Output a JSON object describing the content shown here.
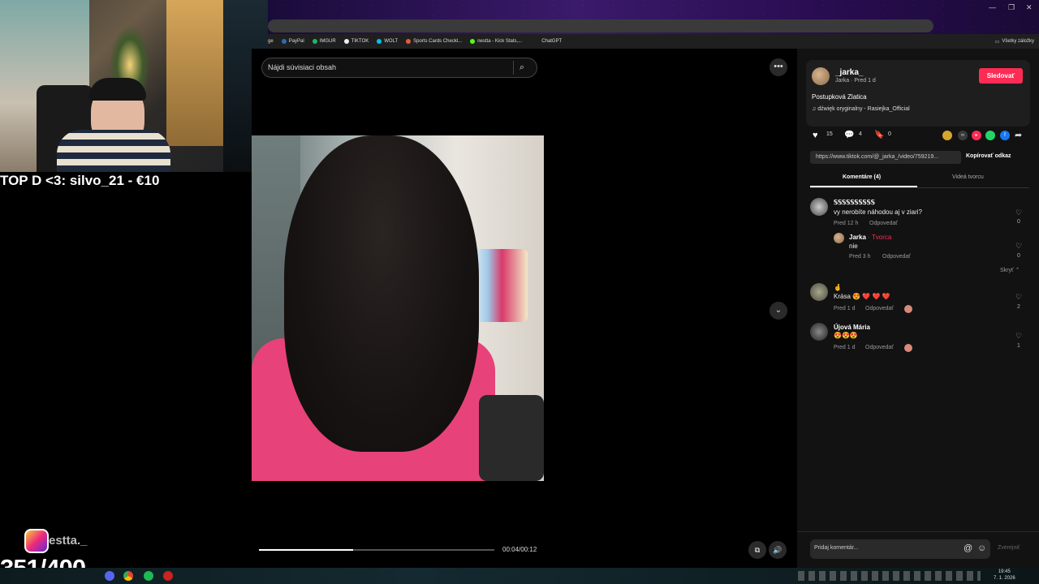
{
  "stream": {
    "donation_text": "TOP D <3: silvo_21 - €10",
    "instagram_handle": "estta._",
    "counter": "351/400"
  },
  "browser": {
    "bookmarks": [
      "ge",
      "PayPal",
      "IMGUR",
      "TIKTOK",
      "WOLT",
      "Sports Cards Checkl...",
      "nestta - Kick Stats,...",
      "ChatGPT"
    ],
    "all_bookmarks": "Všetky záložky"
  },
  "video": {
    "search_placeholder": "Nájdi súvisiaci obsah",
    "time": "00:04/00:12",
    "progress": 0.4
  },
  "author": {
    "username": "_jarka_",
    "subline": "Jarka · Pred 1 d",
    "follow_label": "Sledovať",
    "caption": "Postupková Zlatica",
    "music": "dźwięk oryginalny - Rasiejka_Official"
  },
  "stats": {
    "likes": "15",
    "comments": "4",
    "saves": "0"
  },
  "link": {
    "url": "https://www.tiktok.com/@_jarka_/video/759219...",
    "copy_label": "Kopírovať odkaz"
  },
  "tabs": {
    "comments": "Komentáre (4)",
    "creator_videos": "Videá tvorcu"
  },
  "comments": [
    {
      "name": "𝕊𝕊𝕊𝕊𝕊𝕊𝕊𝕊𝕊𝕊",
      "text": "vy nerobíte náhodou aj v ziari?",
      "time": "Pred 12 h",
      "reply": "Odpovedať",
      "likes": "0"
    },
    {
      "name": "Jarka",
      "creator": "Tvorca",
      "text": "nie",
      "time": "Pred 3 h",
      "reply": "Odpovedať",
      "likes": "0"
    },
    {
      "name": "🤞",
      "text": "Krása 😍 ❤️ ❤️ ❤️",
      "time": "Pred 1 d",
      "reply": "Odpovedať",
      "likes": "2"
    },
    {
      "name": "Újová Mária",
      "text": "😍😍😍",
      "time": "Pred 1 d",
      "reply": "Odpovedať",
      "likes": "1"
    }
  ],
  "hide_label": "Skryť",
  "comment_box": {
    "placeholder": "Pridaj komentár...",
    "post_label": "Zverejniť"
  },
  "taskbar": {
    "time": "19:45",
    "date": "7. 1. 2026"
  },
  "colors": {
    "accent": "#fe2c55",
    "panel": "#121212"
  }
}
